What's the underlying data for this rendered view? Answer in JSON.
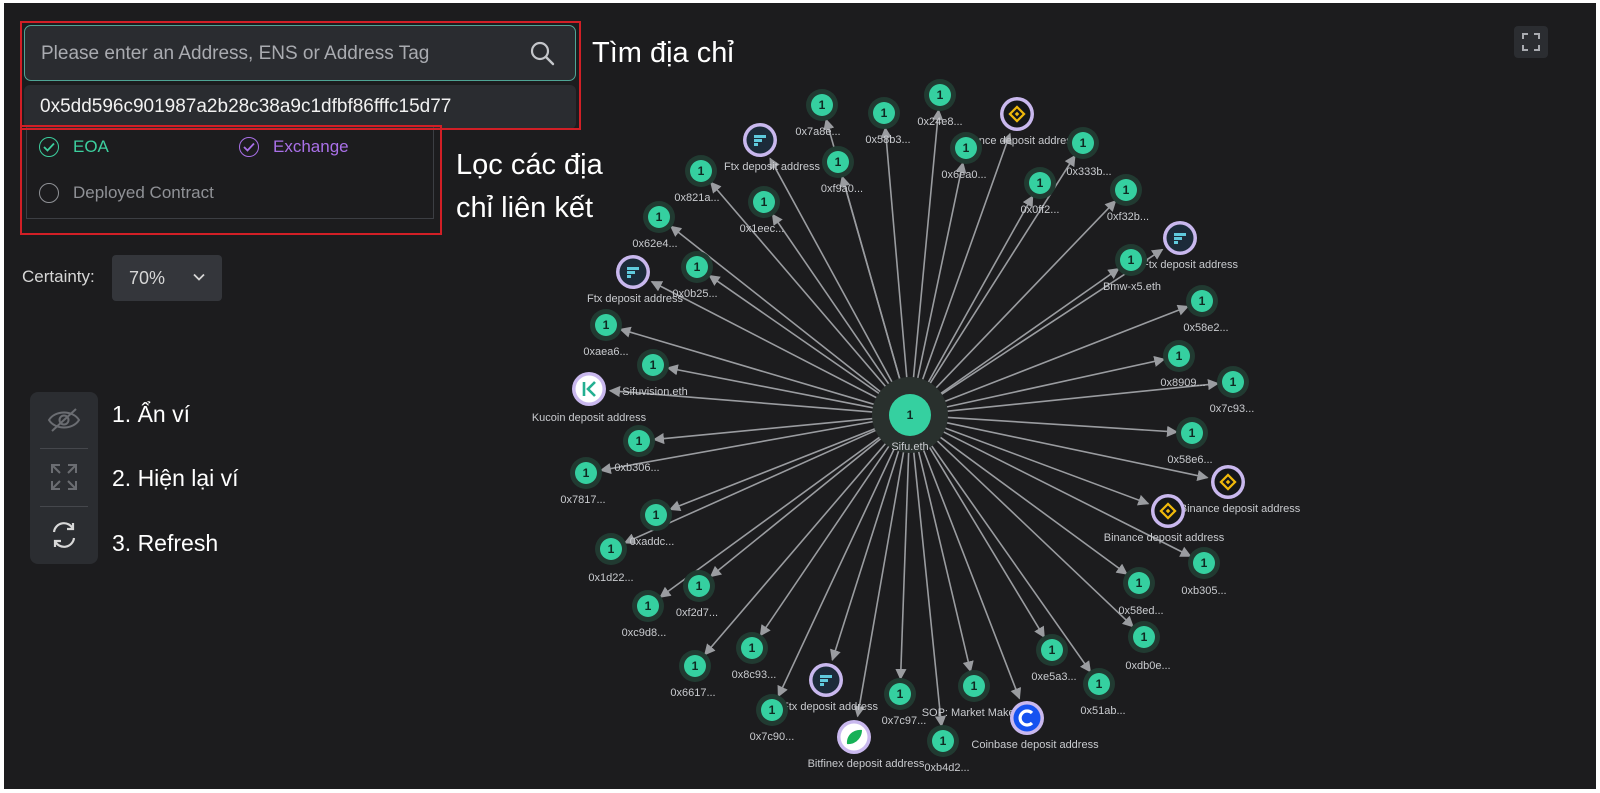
{
  "search": {
    "placeholder": "Please enter an Address, ENS or Address Tag",
    "suggestion": "0x5dd596c901987a2b28c38a9c1dfbf86fffc15d77",
    "icon": "search-icon"
  },
  "filters": {
    "eoa": {
      "label": "EOA",
      "checked": true,
      "color": "#3ccf9e"
    },
    "exchange": {
      "label": "Exchange",
      "checked": true,
      "color": "#a970e8"
    },
    "deployed_contract": {
      "label": "Deployed Contract",
      "checked": false,
      "color": "#8f9196"
    }
  },
  "certainty": {
    "label": "Certainty:",
    "value": "70%"
  },
  "annotations": {
    "search": "Tìm địa chỉ",
    "filter_line1": "Lọc các địa",
    "filter_line2": "chỉ liên kết",
    "hide": "1. Ẩn ví",
    "show": "2. Hiện lại ví",
    "refresh": "3. Refresh"
  },
  "toolbar": {
    "icons": [
      "eye-off-icon",
      "expand-icon",
      "refresh-icon"
    ]
  },
  "colors": {
    "background": "#1c1c1e",
    "eoa_node": "#35d0a0",
    "edge": "#9a9ca0",
    "highlight_box": "#d11f26",
    "exchange_ring": "#c9b8ee",
    "binance": "#f0b90b",
    "ftx": "#5fcade",
    "coinbase": "#1652f0",
    "kucoin": "#23af91",
    "bitfinex": "#16b157"
  },
  "graph": {
    "center": {
      "label": "Sifu.eth",
      "count": "1"
    },
    "nodes": [
      {
        "label": "0x7a8e...",
        "count": "1",
        "type": "eoa"
      },
      {
        "label": "0x58b3...",
        "count": "1",
        "type": "eoa"
      },
      {
        "label": "0x24e8...",
        "count": "1",
        "type": "eoa"
      },
      {
        "label": "Binance deposit address",
        "type": "binance"
      },
      {
        "label": "Ftx deposit address",
        "type": "ftx"
      },
      {
        "label": "0xf9a0...",
        "count": "1",
        "type": "eoa"
      },
      {
        "label": "0x6ea0...",
        "count": "1",
        "type": "eoa"
      },
      {
        "label": "0x333b...",
        "count": "1",
        "type": "eoa"
      },
      {
        "label": "0x821a...",
        "count": "1",
        "type": "eoa"
      },
      {
        "label": "0x1eec...",
        "count": "1",
        "type": "eoa"
      },
      {
        "label": "0x0ff2...",
        "count": "1",
        "type": "eoa"
      },
      {
        "label": "0xf32b...",
        "count": "1",
        "type": "eoa"
      },
      {
        "label": "0x62e4...",
        "count": "1",
        "type": "eoa"
      },
      {
        "label": "Ftx deposit address",
        "type": "ftx"
      },
      {
        "label": "0x0b25...",
        "count": "1",
        "type": "eoa"
      },
      {
        "label": "Ftx deposit address",
        "type": "ftx"
      },
      {
        "label": "Bmw-x5.eth",
        "count": "1",
        "type": "eoa"
      },
      {
        "label": "0x58e2...",
        "count": "1",
        "type": "eoa"
      },
      {
        "label": "0xaea6...",
        "count": "1",
        "type": "eoa"
      },
      {
        "label": "Sifuvision.eth",
        "count": "1",
        "type": "eoa"
      },
      {
        "label": "0x8909...",
        "count": "1",
        "type": "eoa"
      },
      {
        "label": "Kucoin deposit address",
        "type": "kucoin"
      },
      {
        "label": "0x7c93...",
        "count": "1",
        "type": "eoa"
      },
      {
        "label": "0xb306...",
        "count": "1",
        "type": "eoa"
      },
      {
        "label": "0x58e6...",
        "count": "1",
        "type": "eoa"
      },
      {
        "label": "0x7817...",
        "count": "1",
        "type": "eoa"
      },
      {
        "label": "Binance deposit address",
        "type": "binance"
      },
      {
        "label": "0xaddc...",
        "count": "1",
        "type": "eoa"
      },
      {
        "label": "0x1d22...",
        "count": "1",
        "type": "eoa"
      },
      {
        "label": "Binance deposit address",
        "type": "binance"
      },
      {
        "label": "0xb305...",
        "count": "1",
        "type": "eoa"
      },
      {
        "label": "0xf2d7...",
        "count": "1",
        "type": "eoa"
      },
      {
        "label": "0xc9d8...",
        "count": "1",
        "type": "eoa"
      },
      {
        "label": "0x58ed...",
        "count": "1",
        "type": "eoa"
      },
      {
        "label": "0x8c93...",
        "count": "1",
        "type": "eoa"
      },
      {
        "label": "0xdb0e...",
        "count": "1",
        "type": "eoa"
      },
      {
        "label": "0x6617...",
        "count": "1",
        "type": "eoa"
      },
      {
        "label": "Ftx deposit address",
        "type": "ftx"
      },
      {
        "label": "0xe5a3...",
        "count": "1",
        "type": "eoa"
      },
      {
        "label": "0x7c97...",
        "count": "1",
        "type": "eoa"
      },
      {
        "label": "SOP: Market Maker",
        "count": "1",
        "type": "eoa"
      },
      {
        "label": "0x51ab...",
        "count": "1",
        "type": "eoa"
      },
      {
        "label": "0x7c90...",
        "count": "1",
        "type": "eoa"
      },
      {
        "label": "Coinbase deposit address",
        "type": "coinbase"
      },
      {
        "label": "Bitfinex deposit address",
        "type": "bitfinex"
      },
      {
        "label": "0xb4d2...",
        "count": "1",
        "type": "eoa"
      }
    ]
  }
}
